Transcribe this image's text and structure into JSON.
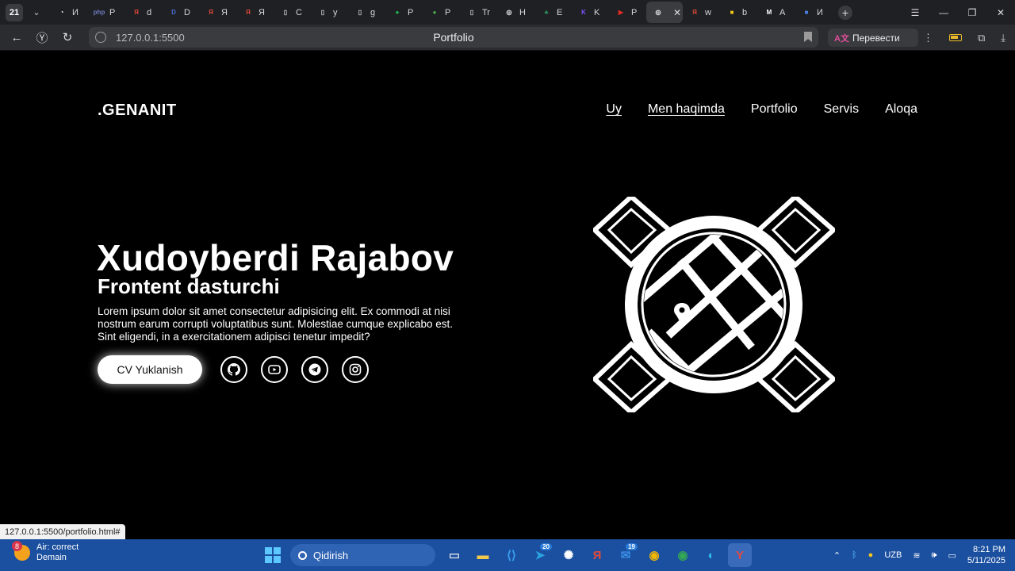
{
  "browser": {
    "tab_count": "21",
    "tabs": [
      {
        "fav": "◔",
        "color": "#ffffff",
        "text": "И"
      },
      {
        "fav": "php",
        "color": "#6b7ac0",
        "text": "P"
      },
      {
        "fav": "Я",
        "color": "#e34a3c",
        "text": "d"
      },
      {
        "fav": "D",
        "color": "#4a6fd8",
        "text": "D"
      },
      {
        "fav": "Я",
        "color": "#e34a3c",
        "text": "Я"
      },
      {
        "fav": "Я",
        "color": "#e34a3c",
        "text": "Я"
      },
      {
        "fav": "▯",
        "color": "#cccccc",
        "text": "C"
      },
      {
        "fav": "▯",
        "color": "#cccccc",
        "text": "y"
      },
      {
        "fav": "▯",
        "color": "#cccccc",
        "text": "g"
      },
      {
        "fav": "●",
        "color": "#1db954",
        "text": "P"
      },
      {
        "fav": "●",
        "color": "#4caf50",
        "text": "P"
      },
      {
        "fav": "▯",
        "color": "#cccccc",
        "text": "Tr"
      },
      {
        "fav": "◎",
        "color": "#ffffff",
        "text": "H"
      },
      {
        "fav": "♣",
        "color": "#2e8b57",
        "text": "E"
      },
      {
        "fav": "K",
        "color": "#7f52ff",
        "text": "K"
      },
      {
        "fav": "▶",
        "color": "#e52d27",
        "text": "P"
      },
      {
        "fav": "◎",
        "color": "#ffffff",
        "text": "",
        "active": true
      },
      {
        "fav": "Я",
        "color": "#e34a3c",
        "text": "w"
      },
      {
        "fav": "■",
        "color": "#f0c419",
        "text": "b"
      },
      {
        "fav": "M",
        "color": "#ffffff",
        "text": "A"
      },
      {
        "fav": "■",
        "color": "#4a7fe0",
        "text": "И"
      }
    ],
    "url": "127.0.0.1:5500",
    "page_title": "Portfolio",
    "translate_label": "Перевести",
    "status_url": "127.0.0.1:5500/portfolio.html#"
  },
  "site": {
    "logo": ".GENANIT",
    "nav": [
      {
        "label": "Uy",
        "underlined": true
      },
      {
        "label": "Men haqimda",
        "underlined": true
      },
      {
        "label": "Portfolio",
        "underlined": false
      },
      {
        "label": "Servis",
        "underlined": false
      },
      {
        "label": "Aloqa",
        "underlined": false
      }
    ],
    "hero": {
      "name": "Xudoyberdi Rajabov",
      "role": "Frontent dasturchi",
      "description": "Lorem ipsum dolor sit amet consectetur adipisicing elit. Ex commodi at nisi nostrum earum corrupti voluptatibus sunt. Molestiae cumque explicabo est. Sint eligendi, in a exercitationem adipisci tenetur impedit?",
      "cv_button": "CV Yuklanish"
    },
    "socials": [
      "github-icon",
      "youtube-icon",
      "telegram-icon",
      "instagram-icon"
    ]
  },
  "taskbar": {
    "weather_badge": "8",
    "weather_title": "Air: correct",
    "weather_sub": "Demain",
    "search_placeholder": "Qidirish",
    "apps": [
      {
        "name": "task-view",
        "glyph": "▭",
        "color": "#cfd8e3"
      },
      {
        "name": "file-explorer",
        "glyph": "▬",
        "color": "#f2c94c"
      },
      {
        "name": "vscode",
        "glyph": "⟨⟩",
        "color": "#3aa0f0"
      },
      {
        "name": "telegram",
        "glyph": "➤",
        "color": "#2aa3e0",
        "badge": "20"
      },
      {
        "name": "chatgpt",
        "glyph": "✺",
        "color": "#ffffff"
      },
      {
        "name": "yandex",
        "glyph": "Я",
        "color": "#e34a3c"
      },
      {
        "name": "mail",
        "glyph": "✉",
        "color": "#3a8ee6",
        "badge": "19"
      },
      {
        "name": "chrome",
        "glyph": "◉",
        "color": "#f2b705"
      },
      {
        "name": "chrome-profile",
        "glyph": "◉",
        "color": "#34a853"
      },
      {
        "name": "edge",
        "glyph": "◐",
        "color": "#2dbbe6"
      },
      {
        "name": "yandex-browser",
        "glyph": "Y",
        "color": "#e34a3c",
        "active": true
      }
    ],
    "lang": "UZB",
    "time": "8:21 PM",
    "date": "5/11/2025"
  }
}
